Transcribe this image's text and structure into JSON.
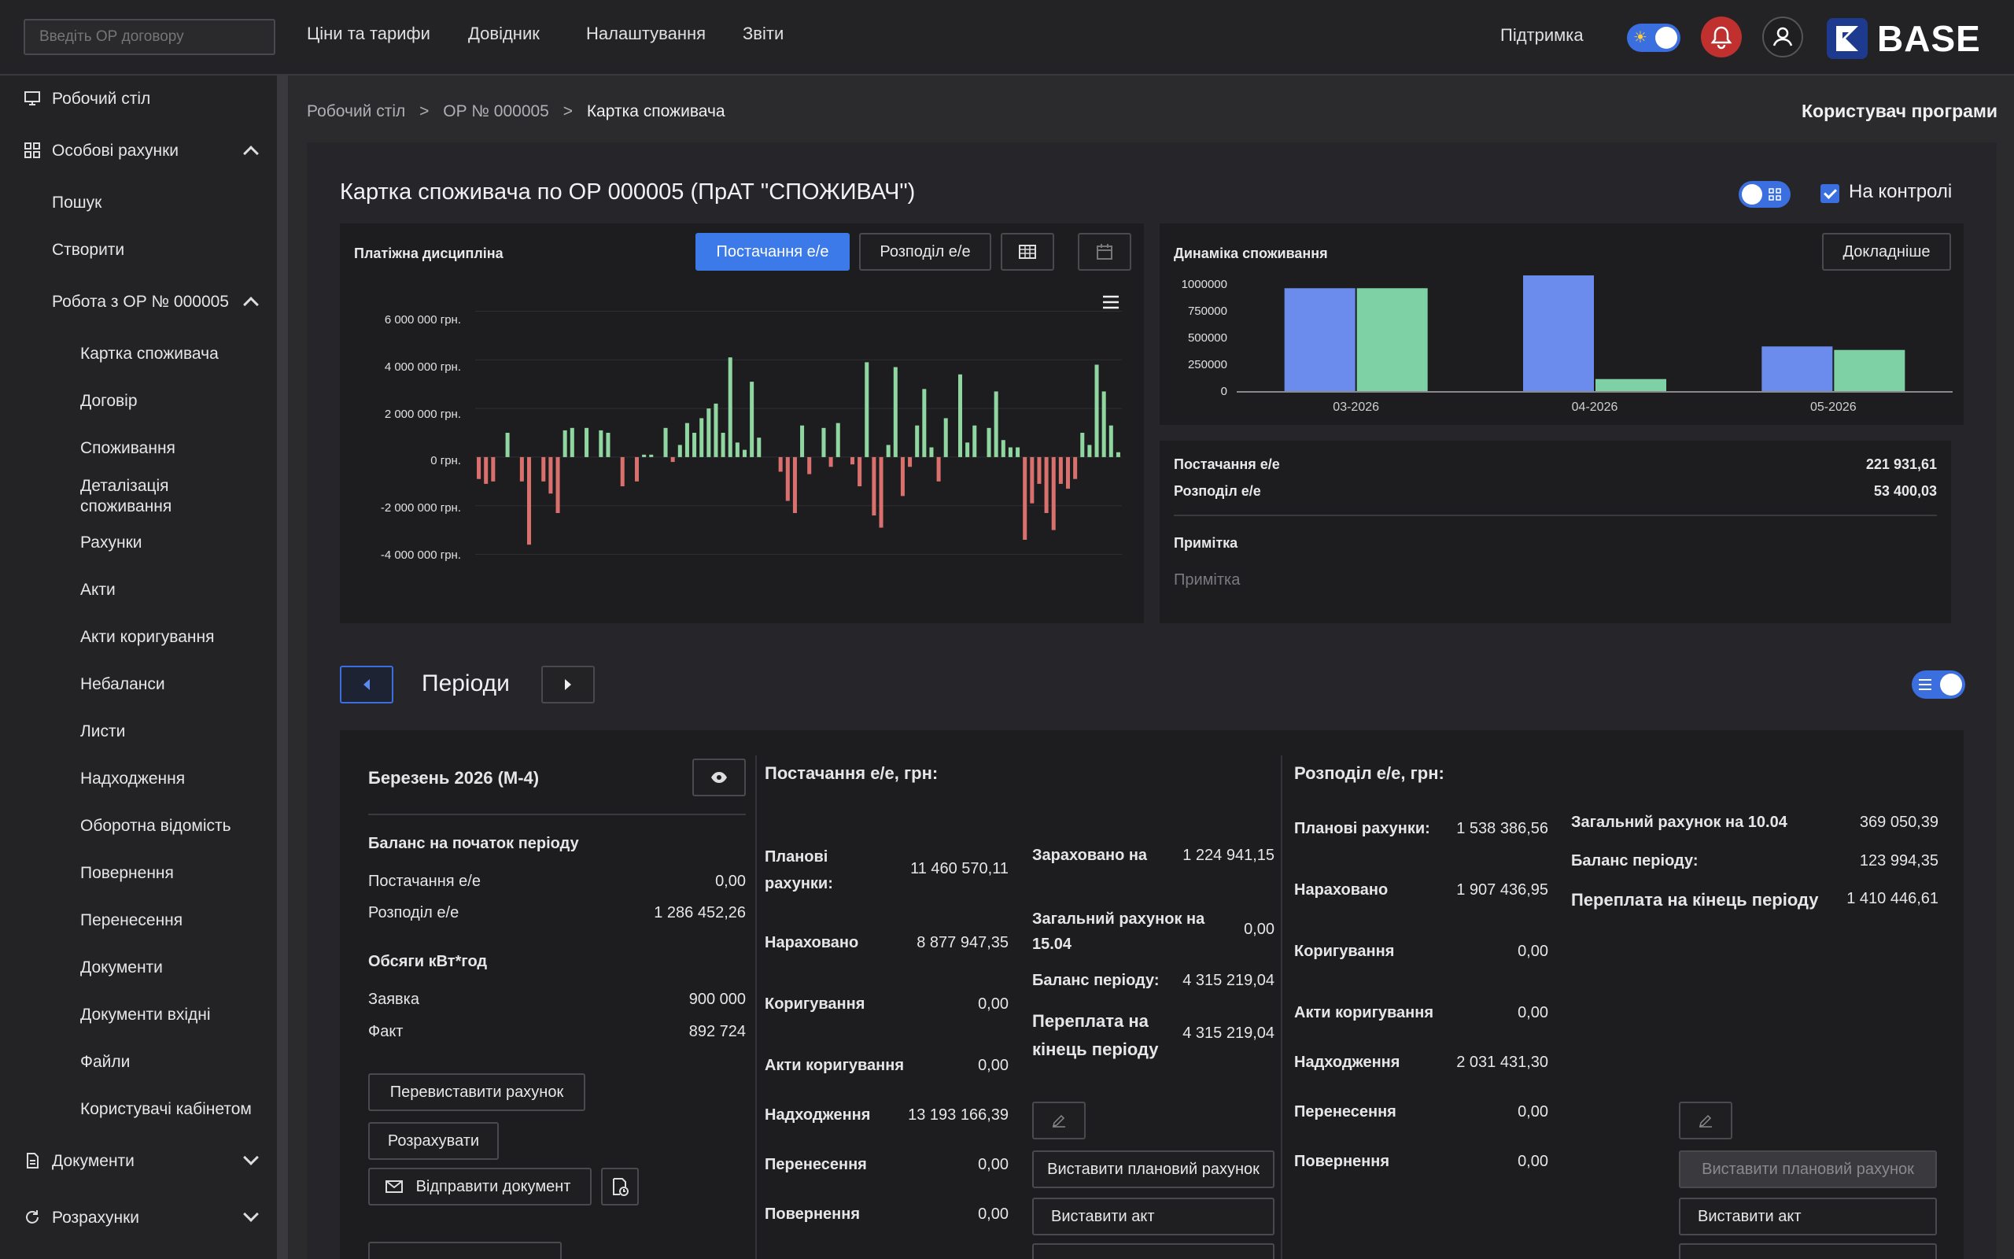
{
  "header": {
    "search_placeholder": "Введіть ОР договору",
    "nav": [
      "Ціни та тарифи",
      "Довідник",
      "Налаштування",
      "Звіти"
    ],
    "support": "Підтримка",
    "logo": "BASE"
  },
  "sidebar": {
    "items": [
      {
        "label": "Робочий стіл",
        "icon": "monitor-icon"
      },
      {
        "label": "Особові рахунки",
        "icon": "grid-icon"
      },
      {
        "label": "Пошук"
      },
      {
        "label": "Створити"
      },
      {
        "label": "Робота з ОР № 000005"
      },
      {
        "label": "Картка споживача"
      },
      {
        "label": "Договір"
      },
      {
        "label": "Споживання"
      },
      {
        "label": "Деталізація споживання"
      },
      {
        "label": "Рахунки"
      },
      {
        "label": "Акти"
      },
      {
        "label": "Акти коригування"
      },
      {
        "label": "Небаланси"
      },
      {
        "label": "Листи"
      },
      {
        "label": "Надходження"
      },
      {
        "label": "Оборотна відомість"
      },
      {
        "label": "Повернення"
      },
      {
        "label": "Перенесення"
      },
      {
        "label": "Документи"
      },
      {
        "label": "Документи вхідні"
      },
      {
        "label": "Файли"
      },
      {
        "label": "Користувачі кабінетом"
      },
      {
        "label": "Документи",
        "icon": "document-icon"
      },
      {
        "label": "Розрахунки",
        "icon": "refresh-icon"
      }
    ]
  },
  "breadcrumbs": [
    "Робочий стіл",
    ">",
    "ОР № 000005",
    ">",
    "Картка споживача"
  ],
  "program_user": "Користувач програми",
  "card": {
    "title": "Картка споживача по ОР 000005 (ПрАТ \"СПОЖИВАЧ\")",
    "control_label": "На контролі"
  },
  "payment_panel": {
    "title": "Платіжна дисципліна",
    "btn_supply": "Постачання е/е",
    "btn_distribution": "Розподіл е/е",
    "y_ticks": [
      "6 000 000 грн.",
      "4 000 000 грн.",
      "2 000 000 грн.",
      "0 грн.",
      "-2 000 000 грн.",
      "-4 000 000 грн."
    ]
  },
  "dynamics_panel": {
    "title": "Динаміка споживання",
    "btn_details": "Докладніше",
    "y_ticks": [
      "1000000",
      "750000",
      "500000",
      "250000",
      "0"
    ]
  },
  "summary": {
    "supply_label": "Постачання е/е",
    "supply_value": "221 931,61",
    "distribution_label": "Розподіл е/е",
    "distribution_value": "53 400,03",
    "note_label": "Примітка",
    "note_placeholder": "Примітка"
  },
  "periods": {
    "title": "Періоди",
    "period_name": "Березень 2026  (М-4)",
    "balance_header": "Баланс на початок періоду",
    "balance_rows": [
      {
        "label": "Постачання е/е",
        "value": "0,00"
      },
      {
        "label": "Розподіл е/е",
        "value": "1 286 452,26"
      }
    ],
    "volumes_header": "Обсяги кВт*год",
    "volume_rows": [
      {
        "label": "Заявка",
        "value": "900 000"
      },
      {
        "label": "Факт",
        "value": "892 724"
      }
    ],
    "btn_reissue": "Перевиставити рахунок",
    "btn_calculate": "Розрахувати",
    "btn_send": "Відправити документ"
  },
  "supply_block": {
    "title": "Постачання е/е, грн:",
    "rows": [
      {
        "label": "Планові рахунки:",
        "value": "11 460 570,11"
      },
      {
        "label": "Нараховано",
        "value": "8 877 947,35"
      },
      {
        "label": "Коригування",
        "value": "0,00"
      },
      {
        "label": "Акти коригування",
        "value": "0,00"
      },
      {
        "label": "Надходження",
        "value": "13 193 166,39"
      },
      {
        "label": "Перенесення",
        "value": "0,00"
      },
      {
        "label": "Повернення",
        "value": "0,00"
      }
    ],
    "right_rows": [
      {
        "label": "Зараховано на",
        "value": "1 224 941,15"
      },
      {
        "label": "Загальний рахунок на 15.04",
        "value": "0,00"
      },
      {
        "label": "Баланс періоду:",
        "value": "4 315 219,04"
      },
      {
        "label": "Переплата на кінець періоду",
        "value": "4 315 219,04"
      }
    ],
    "btn_plan": "Виставити плановий рахунок",
    "btn_act": "Виставити акт"
  },
  "distribution_block": {
    "title": "Розподіл е/е, грн:",
    "rows": [
      {
        "label": "Планові рахунки:",
        "value": "1 538 386,56"
      },
      {
        "label": "Нараховано",
        "value": "1 907 436,95"
      },
      {
        "label": "Коригування",
        "value": "0,00"
      },
      {
        "label": "Акти коригування",
        "value": "0,00"
      },
      {
        "label": "Надходження",
        "value": "2 031 431,30"
      },
      {
        "label": "Перенесення",
        "value": "0,00"
      },
      {
        "label": "Повернення",
        "value": "0,00"
      }
    ],
    "right_rows": [
      {
        "label": "Загальний рахунок на 10.04",
        "value": "369 050,39"
      },
      {
        "label": "Баланс періоду:",
        "value": "123 994,35"
      },
      {
        "label": "Переплата на кінець періоду",
        "value": "1 410 446,61"
      }
    ],
    "btn_plan": "Виставити плановий рахунок",
    "btn_act": "Виставити акт"
  },
  "chart_data": [
    {
      "type": "bar",
      "title": "Платіжна дисципліна",
      "ylim": [
        -4500000,
        6500000
      ],
      "y_ticks": [
        6000000,
        4000000,
        2000000,
        0,
        -2000000,
        -4000000
      ],
      "values": [
        -900000,
        -1100000,
        -1000000,
        0,
        1000000,
        0,
        -1000000,
        -3600000,
        0,
        -1000000,
        -1500000,
        -2300000,
        1100000,
        1200000,
        0,
        1200000,
        0,
        1100000,
        1000000,
        0,
        -1200000,
        0,
        -1000000,
        100000,
        100000,
        0,
        1200000,
        -200000,
        500000,
        1400000,
        1000000,
        1600000,
        2000000,
        2200000,
        1000000,
        4100000,
        600000,
        300000,
        3100000,
        800000,
        0,
        0,
        -600000,
        -1800000,
        -2300000,
        1300000,
        -700000,
        0,
        1200000,
        -400000,
        1400000,
        0,
        -300000,
        -1200000,
        3900000,
        -2400000,
        -2900000,
        500000,
        3700000,
        -1600000,
        -400000,
        1300000,
        2800000,
        400000,
        -1000000,
        1600000,
        0,
        3400000,
        600000,
        1300000,
        0,
        1200000,
        2700000,
        700000,
        400000,
        400000,
        -3400000,
        -1900000,
        -1100000,
        -2300000,
        -3000000,
        -1100000,
        -1300000,
        -900000,
        1000000,
        500000,
        3800000,
        2700000,
        1300000,
        200000
      ]
    },
    {
      "type": "bar",
      "title": "Динаміка споживання",
      "categories": [
        "03-2026",
        "04-2026",
        "05-2026"
      ],
      "ylim": [
        0,
        1000000
      ],
      "series": [
        {
          "color": "#6b8cec",
          "values": [
            890000,
            1000000,
            390000
          ]
        },
        {
          "color": "#7ed0a5",
          "values": [
            890000,
            110000,
            360000
          ]
        }
      ]
    }
  ],
  "colors": {
    "accent": "#3b7ae8",
    "positive": "#8fd6a0",
    "negative": "#d9706d",
    "danger": "#c0302e"
  }
}
